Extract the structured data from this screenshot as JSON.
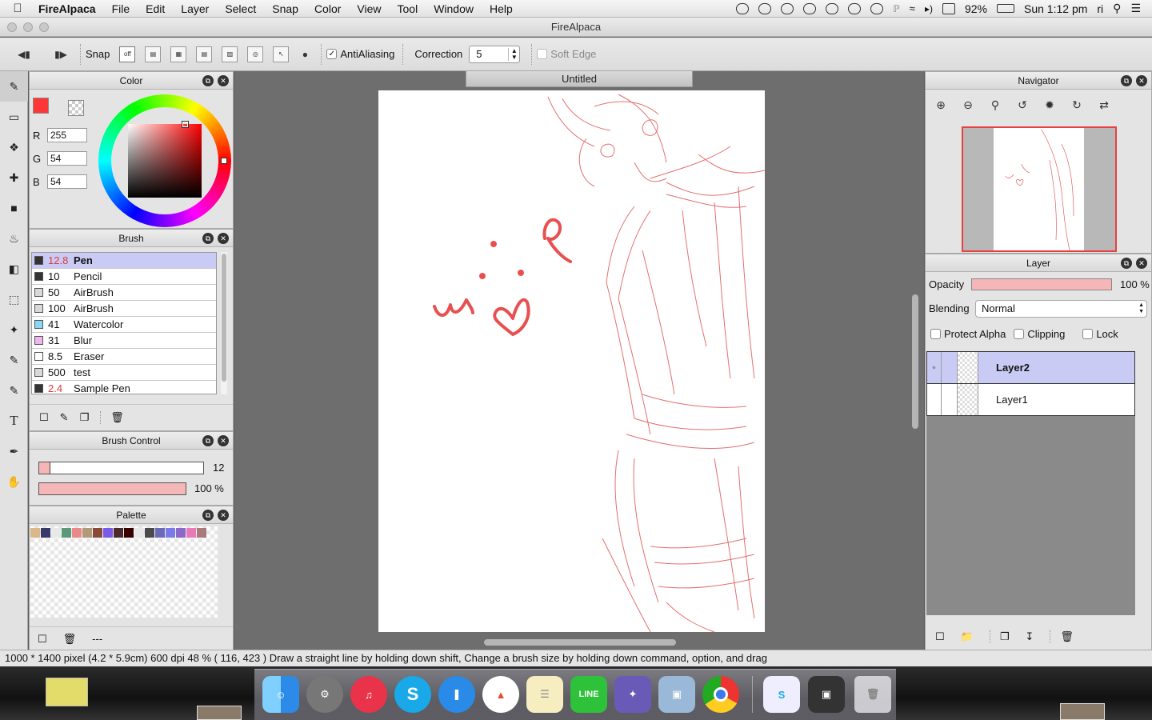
{
  "menubar": {
    "app_name": "FireAlpaca",
    "items": [
      "File",
      "Edit",
      "Layer",
      "Select",
      "Snap",
      "Color",
      "View",
      "Tool",
      "Window",
      "Help"
    ],
    "battery": "92%",
    "clock": "Sun 1:12 pm",
    "user": "ri"
  },
  "window": {
    "title": "FireAlpaca"
  },
  "toolbar": {
    "snap_label": "Snap",
    "snap_off": "off",
    "antialiasing_label": "AntiAliasing",
    "antialiasing_checked": true,
    "correction_label": "Correction",
    "correction_value": "5",
    "soft_edge_label": "Soft Edge",
    "soft_edge_checked": false
  },
  "color_panel": {
    "title": "Color",
    "r_label": "R",
    "r": "255",
    "g_label": "G",
    "g": "54",
    "b_label": "B",
    "b": "54",
    "current_color": "#ff3636"
  },
  "brush_panel": {
    "title": "Brush",
    "items": [
      {
        "size": "12.8",
        "name": "Pen",
        "swatch": "#333333",
        "red": true,
        "selected": true
      },
      {
        "size": "10",
        "name": "Pencil",
        "swatch": "#333333",
        "red": false,
        "selected": false
      },
      {
        "size": "50",
        "name": "AirBrush",
        "swatch": "#d9d9d9",
        "red": false,
        "selected": false
      },
      {
        "size": "100",
        "name": "AirBrush",
        "swatch": "#d9d9d9",
        "red": false,
        "selected": false
      },
      {
        "size": "41",
        "name": "Watercolor",
        "swatch": "#88d8f5",
        "red": false,
        "selected": false
      },
      {
        "size": "31",
        "name": "Blur",
        "swatch": "#f0b4ee",
        "red": false,
        "selected": false
      },
      {
        "size": "8.5",
        "name": "Eraser",
        "swatch": "#ffffff",
        "red": false,
        "selected": false
      },
      {
        "size": "500",
        "name": "test",
        "swatch": "#d9d9d9",
        "red": false,
        "selected": false
      },
      {
        "size": "2.4",
        "name": "Sample Pen",
        "swatch": "#333333",
        "red": true,
        "selected": false
      }
    ]
  },
  "brush_control": {
    "title": "Brush Control",
    "size_value": "12",
    "size_fraction": 0.07,
    "opacity_value": "100 %",
    "opacity_fraction": 1.0
  },
  "palette": {
    "title": "Palette",
    "colors": [
      "#d9b98a",
      "#3a3a6a",
      "#e8e8e8",
      "#5a9a7a",
      "#e88a8a",
      "#b09a7a",
      "#8a4a3a",
      "#7a5ae8",
      "#4a2a2a",
      "#3a0000",
      "#e8e8e8",
      "#4a4a4a",
      "#6a6ab8",
      "#7a7ae8",
      "#8a6ac8",
      "#e87ab8",
      "#a87a7a"
    ],
    "footer_text": "---"
  },
  "document": {
    "tab_title": "Untitled"
  },
  "status_bar": {
    "text": "1000 * 1400 pixel   (4.2 * 5.9cm)   600 dpi   48 %   ( 116, 423 )   Draw a straight line by holding down shift, Change a brush size by holding down command, option, and drag"
  },
  "navigator": {
    "title": "Navigator"
  },
  "layer_panel": {
    "title": "Layer",
    "opacity_label": "Opacity",
    "opacity_value": "100 %",
    "blending_label": "Blending",
    "blending_value": "Normal",
    "protect_alpha_label": "Protect Alpha",
    "clipping_label": "Clipping",
    "lock_label": "Lock",
    "layers": [
      {
        "name": "Layer2",
        "selected": true
      },
      {
        "name": "Layer1",
        "selected": false
      }
    ]
  },
  "canvas_text": "w.i.p",
  "colors": {
    "accent_red": "#e85050",
    "selection_blue": "#c9cbf5",
    "sketch_red": "#e06060"
  }
}
